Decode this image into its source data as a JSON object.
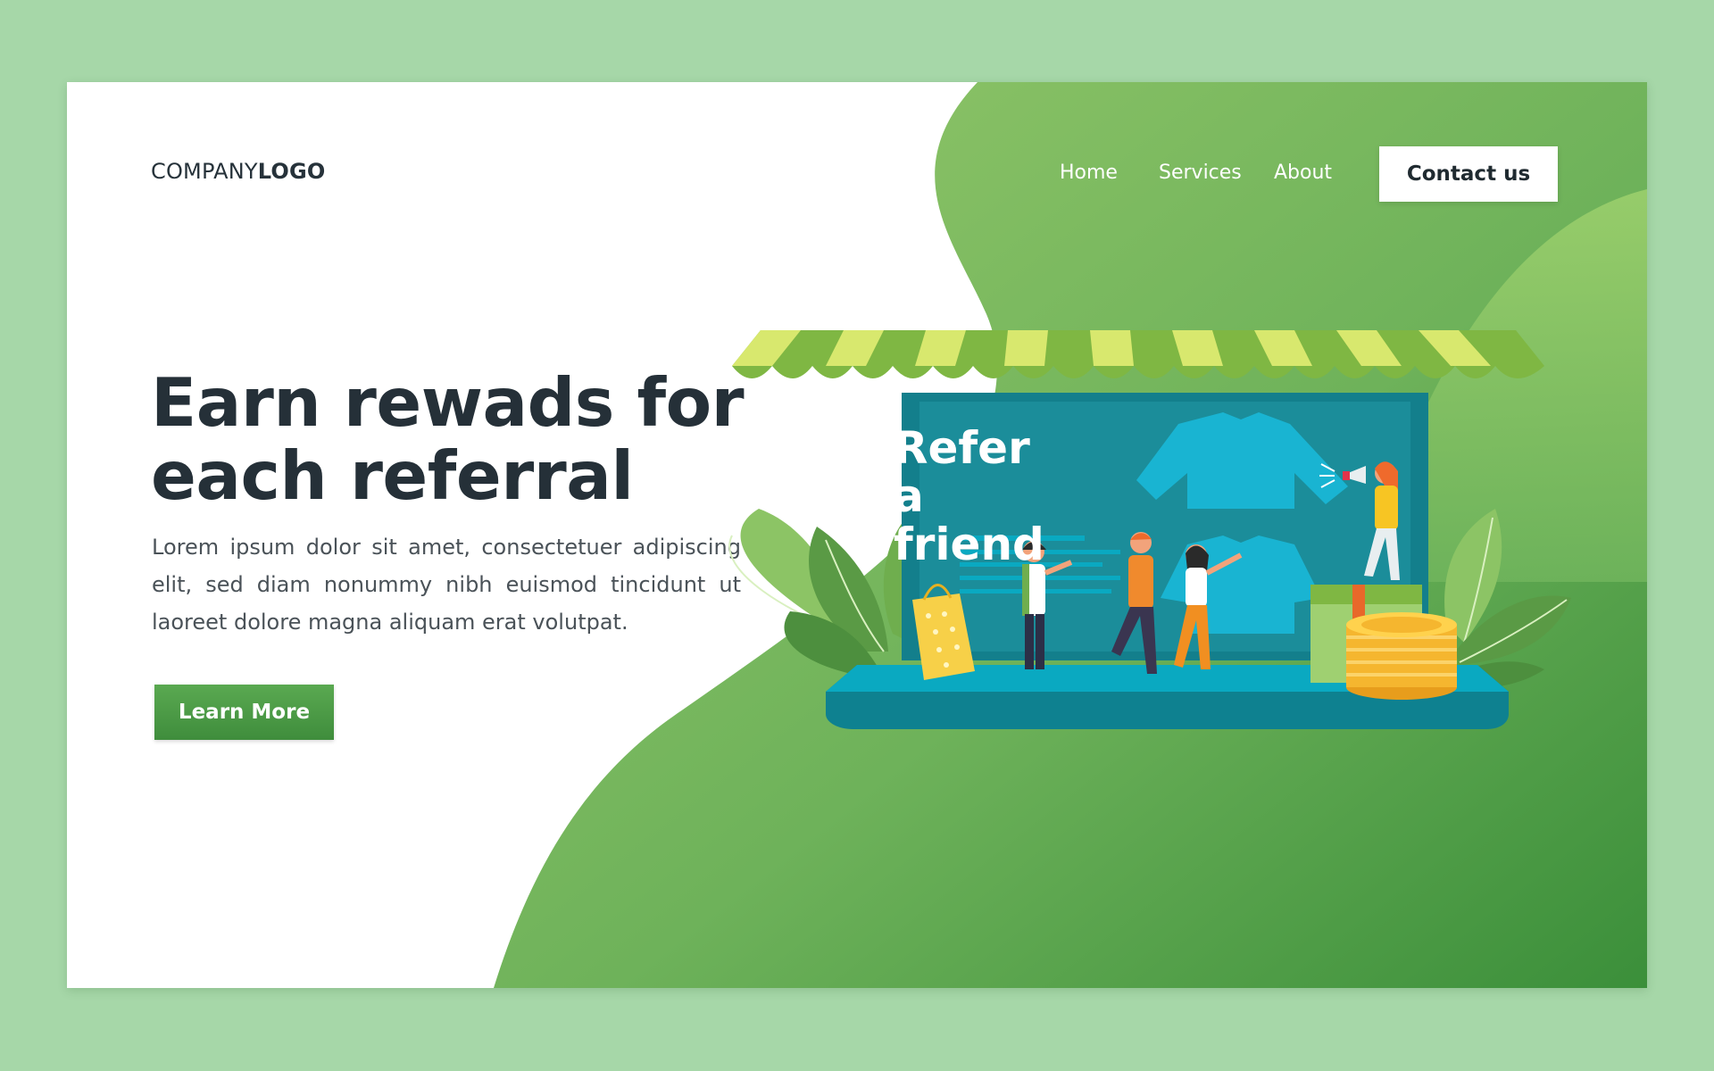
{
  "brand": {
    "company": "COMPANY",
    "logo": "LOGO"
  },
  "nav": {
    "items": [
      {
        "label": "Home"
      },
      {
        "label": "Services"
      },
      {
        "label": "About"
      }
    ],
    "contact_label": "Contact us"
  },
  "hero": {
    "title": "Earn rewads for each referral",
    "body": "Lorem ipsum dolor sit amet, consectetuer adipiscing elit, sed diam nonummy nibh euismod tincidunt ut laoreet dolore magna aliquam erat volutpat.",
    "button_label": "Learn More"
  },
  "illustration": {
    "headline": "Refer a friend",
    "icons": [
      "shop-awning-icon",
      "laptop-icon",
      "shirt-icon",
      "megaphone-icon",
      "shopping-bag-icon",
      "coin-stack-icon",
      "gift-box-icon",
      "leaf-icon",
      "person-icon"
    ]
  },
  "colors": {
    "page_background": "#a6d7a8",
    "accent_green": "#4e9e48",
    "dark_text": "#253038",
    "screen_teal": "#137f8c",
    "awning_light": "#d8e86e",
    "awning_dark": "#7fb743",
    "coin_gold": "#f5b62f"
  }
}
